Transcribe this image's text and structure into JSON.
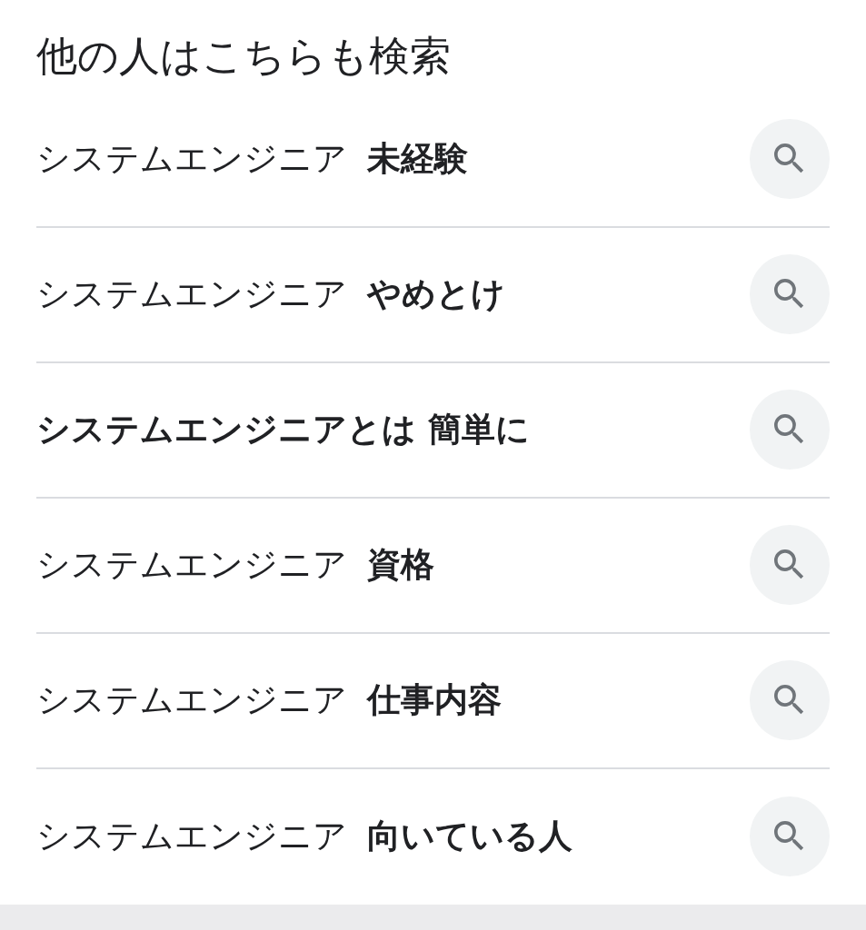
{
  "title": "他の人はこちらも検索",
  "rows": [
    {
      "text": "システムエンジニア **未経験**",
      "bold": false
    },
    {
      "text": "システムエンジニア **やめとけ**",
      "bold": false
    },
    {
      "text": "システムエンジニアとは 簡単に",
      "bold": true
    },
    {
      "text": "システムエンジニア **資格**",
      "bold": false
    },
    {
      "text": "システムエンジニア **仕事内容**",
      "bold": false
    },
    {
      "text": "システムエンジニア **向いている人**",
      "bold": false
    }
  ]
}
